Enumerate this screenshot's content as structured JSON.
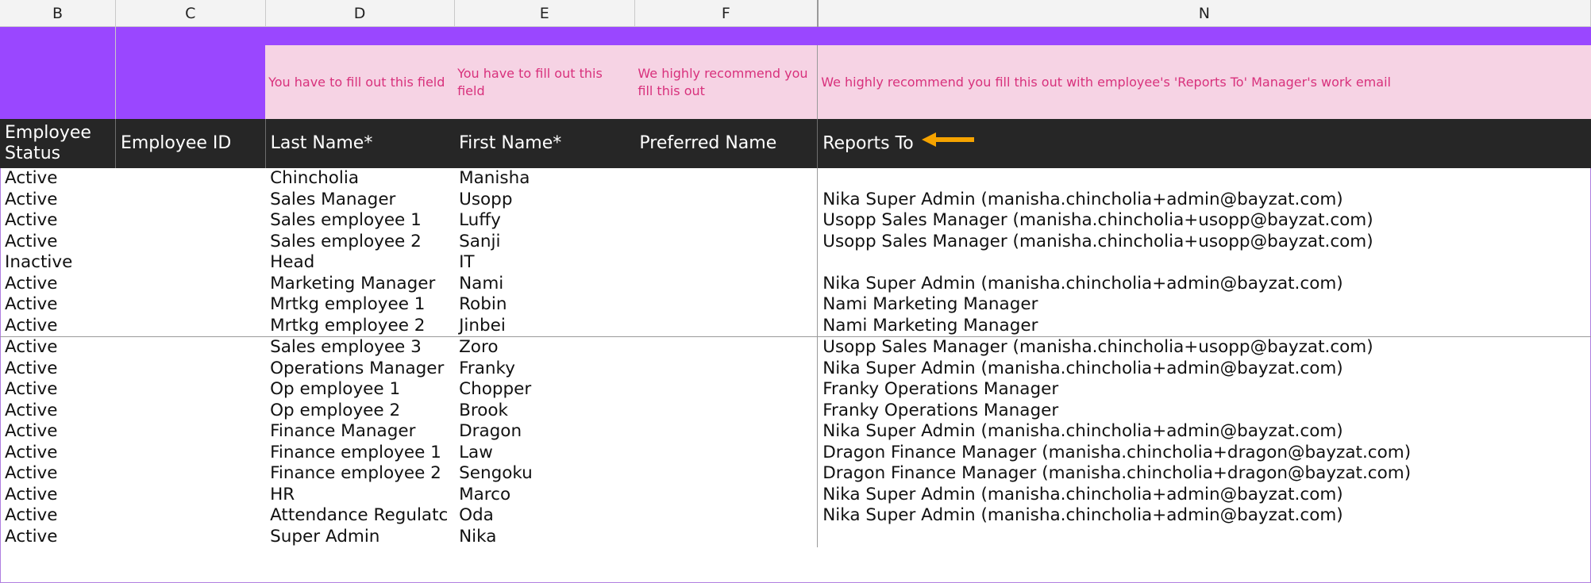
{
  "columns": [
    "B",
    "C",
    "D",
    "E",
    "F",
    "N"
  ],
  "hints": {
    "last_name": "You have to fill out this field",
    "first_name": "You have to fill out this field",
    "preferred_name": "We highly recommend you fill this out",
    "reports_to": "We highly recommend you fill this out with employee's 'Reports To' Manager's work email"
  },
  "headers": {
    "employee_status": "Employee Status",
    "employee_id": "Employee ID",
    "last_name": "Last Name*",
    "first_name": "First Name*",
    "preferred_name": "Preferred Name",
    "reports_to": "Reports To"
  },
  "colors": {
    "band": "#9a47ff",
    "hint_bg": "#f6d3e4",
    "hint_text": "#d8317c",
    "header_bg": "#262626",
    "arrow": "#f5a300"
  },
  "arrow_icon": "left-arrow-icon",
  "rows": [
    {
      "status": "Active",
      "id": "",
      "last": "Chincholia",
      "first": "Manisha",
      "pref": "",
      "reports": ""
    },
    {
      "status": "Active",
      "id": "",
      "last": "Sales Manager",
      "first": "Usopp",
      "pref": "",
      "reports": "Nika Super Admin (manisha.chincholia+admin@bayzat.com)"
    },
    {
      "status": "Active",
      "id": "",
      "last": "Sales employee 1",
      "first": "Luffy",
      "pref": "",
      "reports": "Usopp Sales Manager (manisha.chincholia+usopp@bayzat.com)"
    },
    {
      "status": "Active",
      "id": "",
      "last": "Sales employee 2",
      "first": "Sanji",
      "pref": "",
      "reports": "Usopp Sales Manager (manisha.chincholia+usopp@bayzat.com)"
    },
    {
      "status": "Inactive",
      "id": "",
      "last": "Head",
      "first": "IT",
      "pref": "",
      "reports": ""
    },
    {
      "status": "Active",
      "id": "",
      "last": "Marketing Manager",
      "first": "Nami",
      "pref": "",
      "reports": "Nika Super Admin (manisha.chincholia+admin@bayzat.com)"
    },
    {
      "status": "Active",
      "id": "",
      "last": "Mrtkg employee 1",
      "first": "Robin",
      "pref": "",
      "reports": "Nami Marketing Manager"
    },
    {
      "status": "Active",
      "id": "",
      "last": "Mrtkg employee 2",
      "first": "Jinbei",
      "pref": "",
      "reports": "Nami Marketing Manager"
    },
    {
      "status": "Active",
      "id": "",
      "last": "Sales employee 3",
      "first": "Zoro",
      "pref": "",
      "reports": "Usopp Sales Manager (manisha.chincholia+usopp@bayzat.com)"
    },
    {
      "status": "Active",
      "id": "",
      "last": "Operations Manager",
      "first": "Franky",
      "pref": "",
      "reports": "Nika Super Admin (manisha.chincholia+admin@bayzat.com)"
    },
    {
      "status": "Active",
      "id": "",
      "last": "Op employee 1",
      "first": "Chopper",
      "pref": "",
      "reports": "Franky Operations Manager"
    },
    {
      "status": "Active",
      "id": "",
      "last": "Op employee 2",
      "first": "Brook",
      "pref": "",
      "reports": "Franky Operations Manager"
    },
    {
      "status": "Active",
      "id": "",
      "last": "Finance Manager",
      "first": "Dragon",
      "pref": "",
      "reports": "Nika Super Admin (manisha.chincholia+admin@bayzat.com)"
    },
    {
      "status": "Active",
      "id": "",
      "last": "Finance employee 1",
      "first": "Law",
      "pref": "",
      "reports": "Dragon Finance Manager (manisha.chincholia+dragon@bayzat.com)"
    },
    {
      "status": "Active",
      "id": "",
      "last": "Finance employee 2",
      "first": "Sengoku",
      "pref": "",
      "reports": "Dragon Finance Manager (manisha.chincholia+dragon@bayzat.com)"
    },
    {
      "status": "Active",
      "id": "",
      "last": "HR",
      "first": "Marco",
      "pref": "",
      "reports": "Nika Super Admin (manisha.chincholia+admin@bayzat.com)"
    },
    {
      "status": "Active",
      "id": "",
      "last": "Attendance Regulatc",
      "first": "Oda",
      "pref": "",
      "reports": "Nika Super Admin (manisha.chincholia+admin@bayzat.com)"
    },
    {
      "status": "Active",
      "id": "",
      "last": "Super Admin",
      "first": "Nika",
      "pref": "",
      "reports": ""
    }
  ]
}
